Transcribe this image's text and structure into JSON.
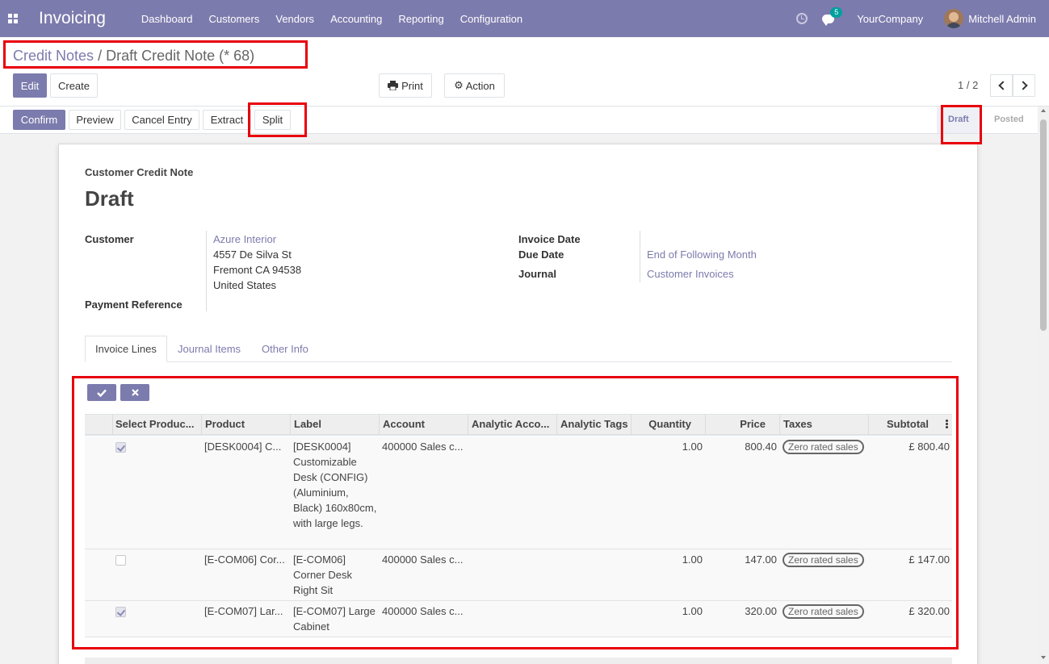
{
  "navbar": {
    "app_name": "Invoicing",
    "menu": [
      "Dashboard",
      "Customers",
      "Vendors",
      "Accounting",
      "Reporting",
      "Configuration"
    ],
    "chat_count": "5",
    "company": "YourCompany",
    "user": "Mitchell Admin"
  },
  "breadcrumb": {
    "parent": "Credit Notes",
    "separator": "/",
    "current": "Draft Credit Note (* 68)"
  },
  "controls": {
    "edit": "Edit",
    "create": "Create",
    "print": "Print",
    "action": "Action",
    "pager": "1 / 2"
  },
  "header_buttons": {
    "confirm": "Confirm",
    "preview": "Preview",
    "cancel_entry": "Cancel Entry",
    "extract": "Extract",
    "split": "Split"
  },
  "statusbar": {
    "draft": "Draft",
    "posted": "Posted"
  },
  "form": {
    "doc_type": "Customer Credit Note",
    "state": "Draft",
    "customer_label": "Customer",
    "customer_name": "Azure Interior",
    "address_line1": "4557 De Silva St",
    "address_line2": "Fremont CA 94538",
    "address_line3": "United States",
    "payment_ref_label": "Payment Reference",
    "invoice_date_label": "Invoice Date",
    "due_date_label": "Due Date",
    "due_date_value": "End of Following Month",
    "journal_label": "Journal",
    "journal_value": "Customer Invoices"
  },
  "tabs": [
    "Invoice Lines",
    "Journal Items",
    "Other Info"
  ],
  "table": {
    "columns": [
      "Select Produc...",
      "Product",
      "Label",
      "Account",
      "Analytic Acco...",
      "Analytic Tags",
      "Quantity",
      "Price",
      "Taxes",
      "Subtotal"
    ],
    "rows": [
      {
        "checked": true,
        "product": "[DESK0004] C...",
        "label": "[DESK0004] Customizable Desk (CONFIG) (Aluminium, Black) 160x80cm, with large legs.",
        "account": "400000 Sales c...",
        "quantity": "1.00",
        "price": "800.40",
        "tax": "Zero rated sales",
        "subtotal": "£ 800.40"
      },
      {
        "checked": false,
        "product": "[E-COM06] Cor...",
        "label": "[E-COM06] Corner Desk Right Sit",
        "account": "400000 Sales c...",
        "quantity": "1.00",
        "price": "147.00",
        "tax": "Zero rated sales",
        "subtotal": "£ 147.00"
      },
      {
        "checked": true,
        "product": "[E-COM07] Lar...",
        "label": "[E-COM07] Large Cabinet",
        "account": "400000 Sales c...",
        "quantity": "1.00",
        "price": "320.00",
        "tax": "Zero rated sales",
        "subtotal": "£ 320.00"
      }
    ]
  },
  "colors": {
    "brand": "#7c7bad",
    "annotation": "#e8000b"
  },
  "icons": [
    "apps-icon",
    "clock-icon",
    "chat-icon",
    "print-icon",
    "gear-icon",
    "chevron-left-icon",
    "chevron-right-icon",
    "check-icon",
    "close-icon",
    "kebab-icon"
  ]
}
